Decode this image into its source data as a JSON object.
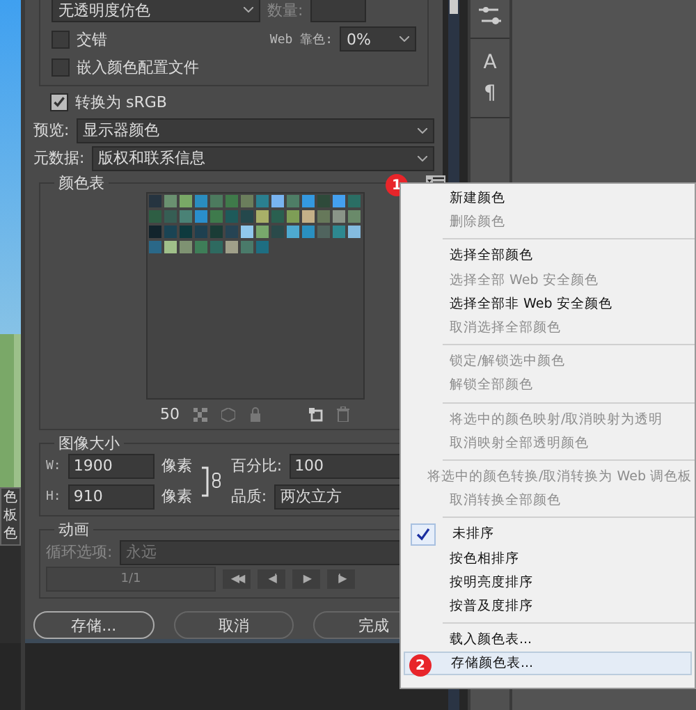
{
  "options": {
    "dither_select": "无透明度仿色",
    "amount_label": "数量:",
    "interlaced": {
      "label": "交错",
      "checked": false
    },
    "web_snap_label": "Web 靠色:",
    "web_snap_value": "0%",
    "embed_profile": {
      "label": "嵌入颜色配置文件",
      "checked": false
    },
    "convert_srgb": {
      "label": "转换为 sRGB",
      "checked": true
    },
    "preview_label": "预览:",
    "preview_value": "显示器颜色",
    "metadata_label": "元数据:",
    "metadata_value": "版权和联系信息"
  },
  "color_table": {
    "title": "颜色表",
    "count": "50",
    "badge": "1",
    "swatches": [
      {
        "color": "#263440"
      },
      {
        "color": "#6a9170"
      },
      {
        "color": "#79a866"
      },
      {
        "color": "#2a8dbf"
      },
      {
        "color": "#4c7a5e"
      },
      {
        "color": "#3f7a4a"
      },
      {
        "color": "#6b7e5c"
      },
      {
        "color": "#2a8090"
      },
      {
        "color": "#78b4f0"
      },
      {
        "color": "#4e7e66"
      },
      {
        "color": "#3499e0"
      },
      {
        "color": "#2e4a3a"
      },
      {
        "color": "#44a0f0"
      },
      {
        "color": "#2a6e64"
      },
      {
        "color": "#2e5e44"
      },
      {
        "color": "#365e54"
      },
      {
        "color": "#4a8276"
      },
      {
        "color": "#2a8ecc"
      },
      {
        "color": "#3e7a4c"
      },
      {
        "color": "#1e5a5a"
      },
      {
        "color": "#24484c"
      },
      {
        "color": "#a8b068"
      },
      {
        "color": "#2a6050"
      },
      {
        "color": "#7e9e56"
      },
      {
        "color": "#c4b088"
      },
      {
        "color": "#66785a"
      },
      {
        "color": "#8a9488"
      },
      {
        "color": "#6a8a6a"
      },
      {
        "color": "#12242c"
      },
      {
        "color": "#1a4454"
      },
      {
        "color": "#0e3a3e"
      },
      {
        "color": "#1e4050"
      },
      {
        "color": "#1a3c36"
      },
      {
        "color": "#264454"
      },
      {
        "color": "#90c8ec"
      },
      {
        "color": "#78a86c"
      },
      {
        "color": "#2a4a4a"
      },
      {
        "color": "#4eaad0"
      },
      {
        "color": "#2a90c0"
      },
      {
        "color": "#50645e"
      },
      {
        "color": "#2e8890"
      },
      {
        "color": "#84bce0"
      },
      {
        "color": "#2a6888"
      },
      {
        "color": "#a0c08a"
      },
      {
        "color": "#7e9272"
      },
      {
        "color": "#3e7e58"
      },
      {
        "color": "#2e6a60"
      },
      {
        "color": "#a0a08a"
      },
      {
        "color": "#4a7a6a"
      },
      {
        "color": "#1e6e82"
      }
    ]
  },
  "image_size": {
    "title": "图像大小",
    "w_label": "W:",
    "w_value": "1900",
    "w_unit": "像素",
    "h_label": "H:",
    "h_value": "910",
    "h_unit": "像素",
    "percent_label": "百分比:",
    "percent_value": "100",
    "quality_label": "品质:",
    "quality_value": "两次立方"
  },
  "animation": {
    "title": "动画",
    "loop_label": "循环选项:",
    "loop_value": "永远",
    "frame": "1/1",
    "controls": [
      "◀◀",
      "◀I",
      "▶",
      "I▶"
    ]
  },
  "buttons": [
    "存储...",
    "取消",
    "完成"
  ],
  "left_strip_texts": [
    "色",
    "板",
    "色"
  ],
  "tool_panel": {
    "glyphs": [
      "A",
      "¶"
    ]
  },
  "menu": {
    "items": [
      {
        "kind": "item",
        "label": "新建颜色",
        "disabled": false,
        "checked": false
      },
      {
        "kind": "item",
        "label": "删除颜色",
        "disabled": true,
        "checked": false
      },
      {
        "kind": "separator"
      },
      {
        "kind": "item",
        "label": "选择全部颜色",
        "disabled": false,
        "checked": false
      },
      {
        "kind": "item",
        "label": "选择全部 Web 安全颜色",
        "disabled": true,
        "checked": false
      },
      {
        "kind": "item",
        "label": "选择全部非 Web 安全颜色",
        "disabled": false,
        "checked": false
      },
      {
        "kind": "item",
        "label": "取消选择全部颜色",
        "disabled": true,
        "checked": false
      },
      {
        "kind": "separator"
      },
      {
        "kind": "item",
        "label": "锁定/解锁选中颜色",
        "disabled": true,
        "checked": false
      },
      {
        "kind": "item",
        "label": "解锁全部颜色",
        "disabled": true,
        "checked": false
      },
      {
        "kind": "separator"
      },
      {
        "kind": "item",
        "label": "将选中的颜色映射/取消映射为透明",
        "disabled": true,
        "checked": false
      },
      {
        "kind": "item",
        "label": "取消映射全部透明颜色",
        "disabled": true,
        "checked": false
      },
      {
        "kind": "separator"
      },
      {
        "kind": "item",
        "label": "将选中的颜色转换/取消转换为 Web 调色板",
        "disabled": true,
        "checked": false
      },
      {
        "kind": "item",
        "label": "取消转换全部颜色",
        "disabled": true,
        "checked": false
      },
      {
        "kind": "separator"
      },
      {
        "kind": "item",
        "label": "未排序",
        "disabled": false,
        "checked": true
      },
      {
        "kind": "item",
        "label": "按色相排序",
        "disabled": false,
        "checked": false
      },
      {
        "kind": "item",
        "label": "按明亮度排序",
        "disabled": false,
        "checked": false
      },
      {
        "kind": "item",
        "label": "按普及度排序",
        "disabled": false,
        "checked": false
      },
      {
        "kind": "separator"
      },
      {
        "kind": "item",
        "label": "载入颜色表...",
        "disabled": false,
        "checked": false
      },
      {
        "kind": "item",
        "label": "存储颜色表...",
        "disabled": false,
        "checked": false,
        "badge": "2",
        "selected": true
      }
    ]
  }
}
